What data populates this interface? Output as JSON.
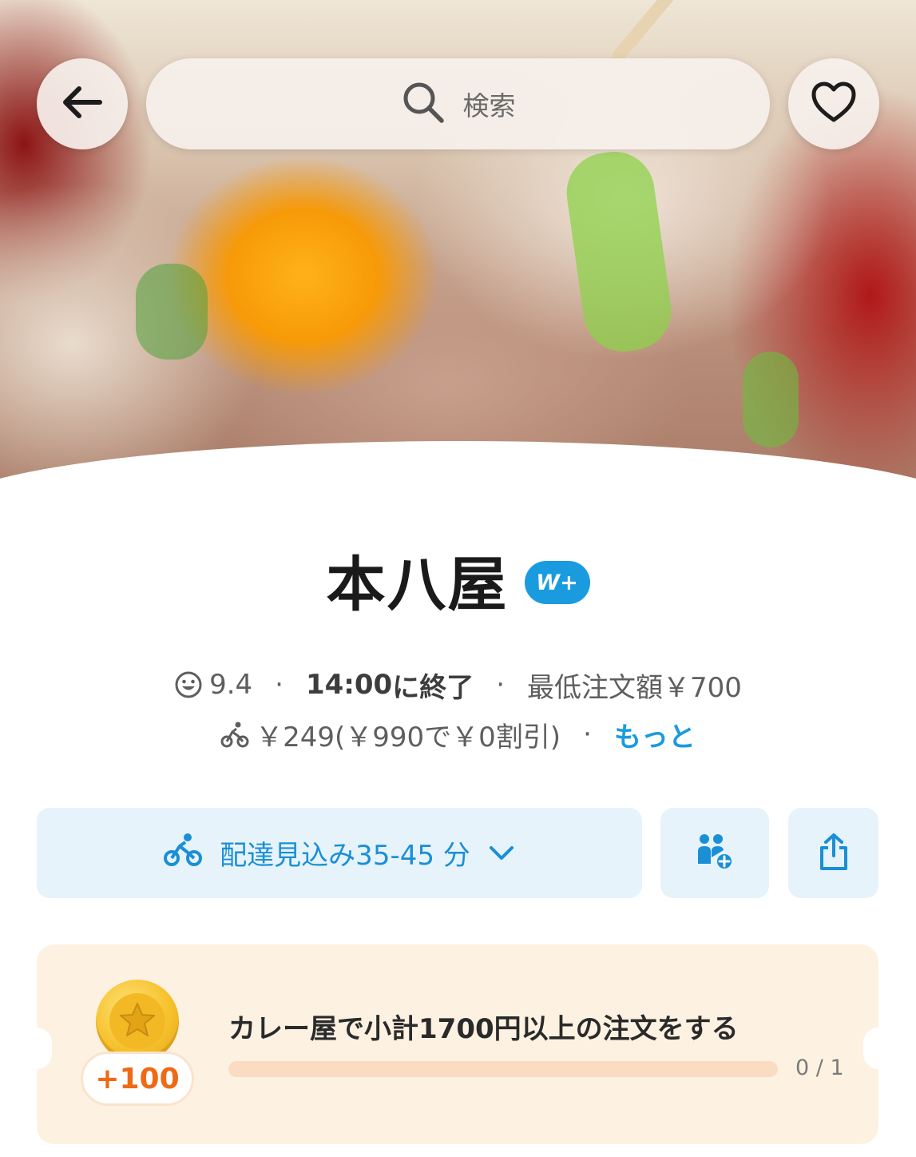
{
  "header": {
    "back_icon": "arrow-left-icon",
    "search_placeholder": "検索",
    "favorite_icon": "heart-outline-icon"
  },
  "store": {
    "name": "本八屋",
    "badge": "W+",
    "badge_color": "#1a9be0",
    "rating": "9.4",
    "closing_time": "14:00",
    "closing_suffix": "に終了",
    "minimum_order": "最低注文額￥700",
    "delivery_fee_text": "￥249(￥990で￥0割引)",
    "more_link": "もっと"
  },
  "actions": {
    "delivery_estimate": "配達見込み35-45 分",
    "group_order_icon": "group-add-icon",
    "share_icon": "share-icon"
  },
  "mission": {
    "points": "+100",
    "description": "カレー屋で小計1700円以上の注文をする",
    "progress_text": "0 / 1",
    "progress_fraction": 0,
    "accent_color": "#ee6a16"
  },
  "colors": {
    "link_blue": "#1a9be0",
    "pill_bg": "#e6f3fb",
    "mission_bg": "#fdf2e2"
  }
}
